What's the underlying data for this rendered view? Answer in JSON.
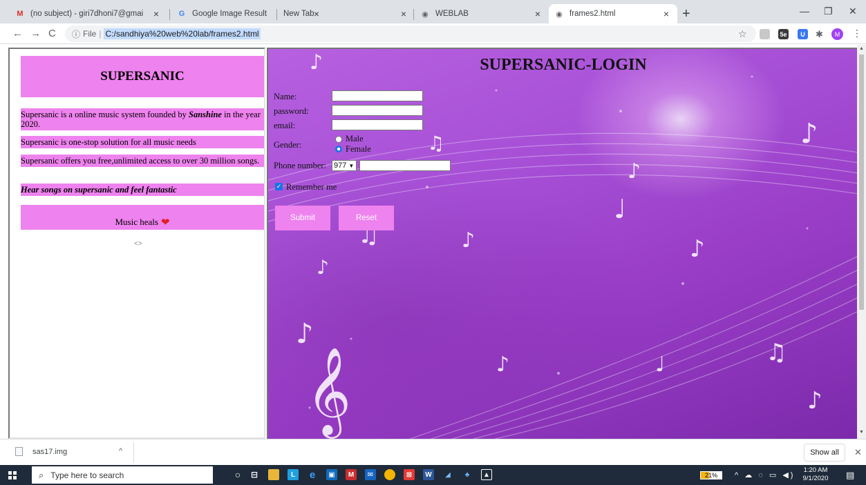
{
  "browser": {
    "tabs": [
      {
        "title": "(no subject) - giri7dhoni7@gmai",
        "favicon": "gmail-icon"
      },
      {
        "title": "Google Image Result",
        "favicon": "google-icon"
      },
      {
        "title": "New Tab",
        "favicon": ""
      },
      {
        "title": "WEBLAB",
        "favicon": "globe-icon"
      },
      {
        "title": "frames2.html",
        "favicon": "globe-icon",
        "active": true
      }
    ],
    "address": {
      "scheme_label": "File",
      "url": "C:/sandhiya%20web%20lab/frames2.html"
    },
    "profile_initial": "M"
  },
  "left_frame": {
    "title": "SUPERSANIC",
    "p1_before": "Supersanic is a online music system founded by ",
    "p1_name": "Sanshine",
    "p1_after": " in the year 2020.",
    "p2": "Supersanic is one-stop solution for all music needs",
    "p3": "Supersanic offers you free,unlimited access to over 30 million songs.",
    "p4": "Hear songs on supersanic and feel fantastic",
    "heal": "Music heals",
    "marquee": "<>"
  },
  "right_frame": {
    "title": "SUPERSANIC-LOGIN",
    "labels": {
      "name": "Name:",
      "password": "password:",
      "email": "email:",
      "gender": "Gender:",
      "male": "Male",
      "female": "Female",
      "phone": "Phone number:",
      "remember": "Remember me"
    },
    "selected_gender": "Female",
    "phone_code": "977",
    "remember_checked": true,
    "submit_label": "Submit",
    "reset_label": "Reset",
    "accent": "#ee82ee"
  },
  "download_bar": {
    "file": "sas17.img",
    "show_all": "Show all"
  },
  "taskbar": {
    "search_placeholder": "Type here to search",
    "battery": "21%",
    "time": "1:20 AM",
    "date": "9/1/2020"
  }
}
